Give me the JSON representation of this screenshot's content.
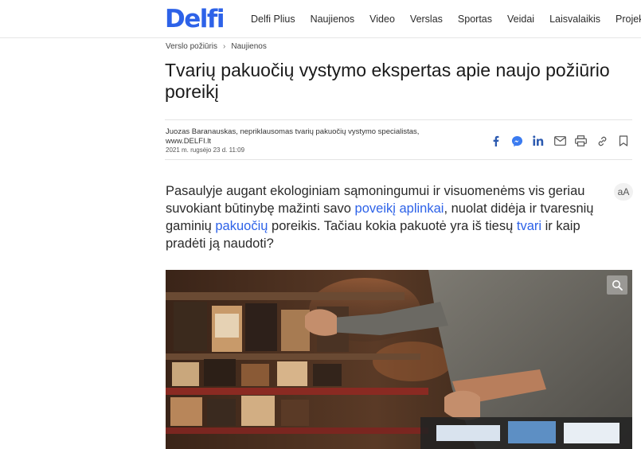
{
  "header": {
    "logo": "Delfi",
    "nav": [
      "Delfi Plius",
      "Naujienos",
      "Video",
      "Verslas",
      "Sportas",
      "Veidai",
      "Laisvalaikis",
      "Projektai"
    ]
  },
  "breadcrumb": [
    "Verslo požiūris",
    "Naujienos"
  ],
  "article": {
    "title": "Tvarių pakuočių vystymo ekspertas apie naujo požiūrio poreikį",
    "author_line1": "Juozas Baranauskas, nepriklausomas tvarių pakuočių vystymo specialistas,",
    "author_line2": "www.DELFI.lt",
    "date": "2021 m. rugsėjo 23 d. 11:09",
    "lead": {
      "part1": "Pasaulyje augant ekologiniam sąmoningumui ir visuomenėms vis geriau suvokiant būtinybę mažinti savo ",
      "link1": "poveikį aplinkai",
      "part2": ", nuolat didėja ir tvaresnių gaminių ",
      "link2": "pakuočių",
      "part3": " poreikis. Tačiau kokia pakuotė yra iš tiesų ",
      "link3": "tvari",
      "part4": " ir kaip pradėti ją naudoti?"
    },
    "font_size_label": "aA"
  },
  "share_icons": [
    "facebook-icon",
    "messenger-icon",
    "linkedin-icon",
    "email-icon",
    "print-icon",
    "link-icon",
    "bookmark-icon"
  ],
  "colors": {
    "brand": "#2d62e8",
    "link": "#2d62e8"
  }
}
